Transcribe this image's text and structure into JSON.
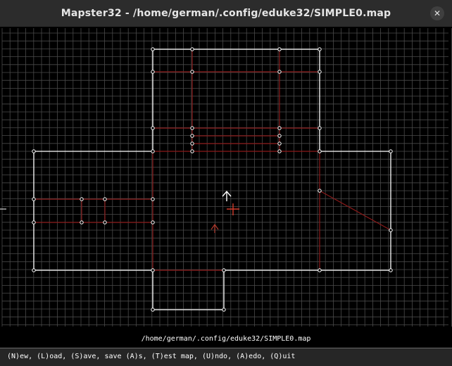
{
  "window": {
    "title": "Mapster32 - /home/german/.config/eduke32/SIMPLE0.map",
    "close_glyph": "✕"
  },
  "status": {
    "map_path": "/home/german/.config/eduke32/SIMPLE0.map"
  },
  "commands": {
    "line": "(N)ew, (L)oad, (S)ave, save (A)s, (T)est map, (U)ndo, (A)edo, (Q)uit"
  },
  "colors": {
    "grid": "#4a4a4a",
    "white_wall": "#ffffff",
    "red_wall": "#8b1a1a",
    "cursor": "#d23c2c"
  },
  "icons": {
    "player_start": "arrow-up-icon",
    "sprite": "arrow-up-icon",
    "cursor": "crosshair-icon",
    "close": "close-icon"
  }
}
